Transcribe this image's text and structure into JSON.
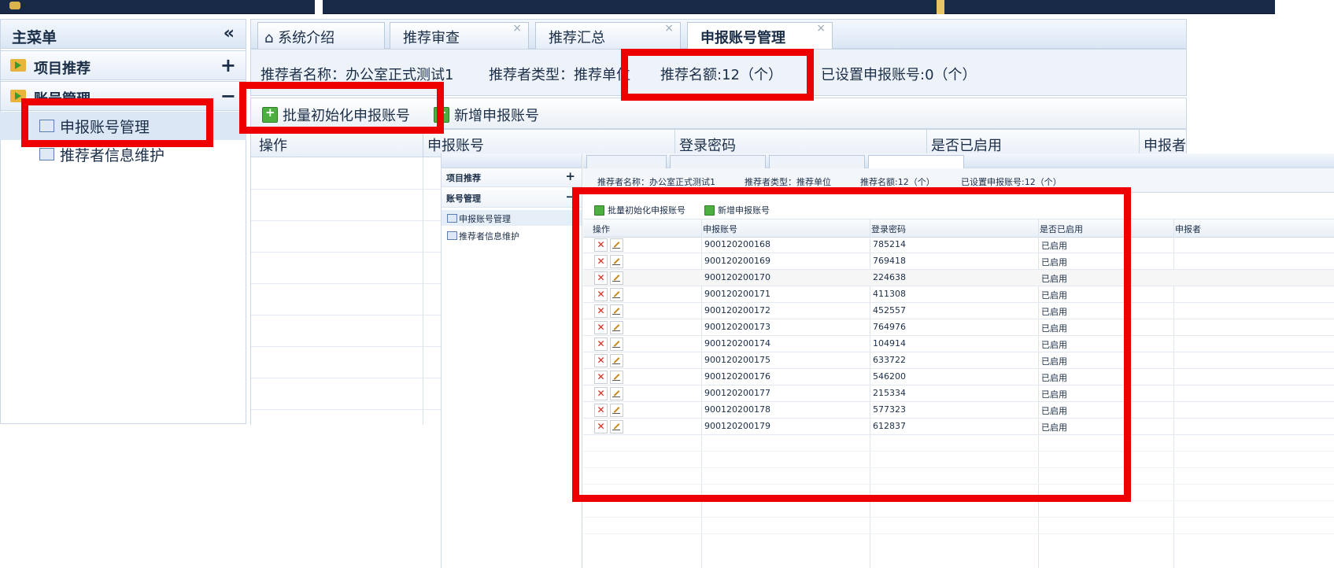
{
  "sidebar": {
    "title": "主菜单",
    "collapse_symbol": "«",
    "groups": [
      {
        "label": "项目推荐",
        "toggle": "+"
      },
      {
        "label": "账号管理",
        "toggle": "−"
      }
    ],
    "items": [
      {
        "label": "申报账号管理"
      },
      {
        "label": "推荐者信息维护"
      }
    ]
  },
  "tabs": [
    {
      "label": "系统介绍"
    },
    {
      "label": "推荐审查",
      "close": "×"
    },
    {
      "label": "推荐汇总",
      "close": "×"
    },
    {
      "label": "申报账号管理",
      "close": "×"
    }
  ],
  "info": {
    "name": "推荐者名称：办公室正式测试1",
    "type": "推荐者类型：推荐单位",
    "quota": "推荐名额:12（个）",
    "set": "已设置申报账号:0（个）"
  },
  "toolbar": {
    "batch_init": "批量初始化申报账号",
    "add": "新增申报账号"
  },
  "grid": {
    "columns": [
      "操作",
      "申报账号",
      "登录密码",
      "是否已启用",
      "申报者"
    ]
  },
  "overlay": {
    "sidebar": {
      "groups": [
        {
          "label": "项目推荐",
          "toggle": "+"
        },
        {
          "label": "账号管理",
          "toggle": "−"
        }
      ],
      "items": [
        {
          "label": "申报账号管理"
        },
        {
          "label": "推荐者信息维护"
        }
      ]
    },
    "info": {
      "name": "推荐者名称：办公室正式测试1",
      "type": "推荐者类型：推荐单位",
      "quota": "推荐名额:12（个）",
      "set": "已设置申报账号:12（个）"
    },
    "toolbar": {
      "batch_init": "批量初始化申报账号",
      "add": "新增申报账号"
    },
    "columns": [
      "操作",
      "申报账号",
      "登录密码",
      "是否已启用",
      "申报者"
    ],
    "rows": [
      {
        "account": "900120200168",
        "password": "785214",
        "status": "已启用"
      },
      {
        "account": "900120200169",
        "password": "769418",
        "status": "已启用"
      },
      {
        "account": "900120200170",
        "password": "224638",
        "status": "已启用"
      },
      {
        "account": "900120200171",
        "password": "411308",
        "status": "已启用"
      },
      {
        "account": "900120200172",
        "password": "452557",
        "status": "已启用"
      },
      {
        "account": "900120200173",
        "password": "764976",
        "status": "已启用"
      },
      {
        "account": "900120200174",
        "password": "104914",
        "status": "已启用"
      },
      {
        "account": "900120200175",
        "password": "633722",
        "status": "已启用"
      },
      {
        "account": "900120200176",
        "password": "546200",
        "status": "已启用"
      },
      {
        "account": "900120200177",
        "password": "215334",
        "status": "已启用"
      },
      {
        "account": "900120200178",
        "password": "577323",
        "status": "已启用"
      },
      {
        "account": "900120200179",
        "password": "612837",
        "status": "已启用"
      }
    ]
  },
  "colors": {
    "highlight": "#ee0000",
    "header_bg": "#182a48",
    "panel_bg": "#dae6f4",
    "delete_icon": "#d8261b",
    "add_icon": "#4caf3f"
  },
  "icons": {
    "home": "home-icon",
    "folder": "folder-icon",
    "list": "list-icon",
    "add": "add-icon",
    "delete": "delete-icon",
    "edit": "edit-icon",
    "close": "close-icon",
    "collapse": "collapse-icon"
  }
}
